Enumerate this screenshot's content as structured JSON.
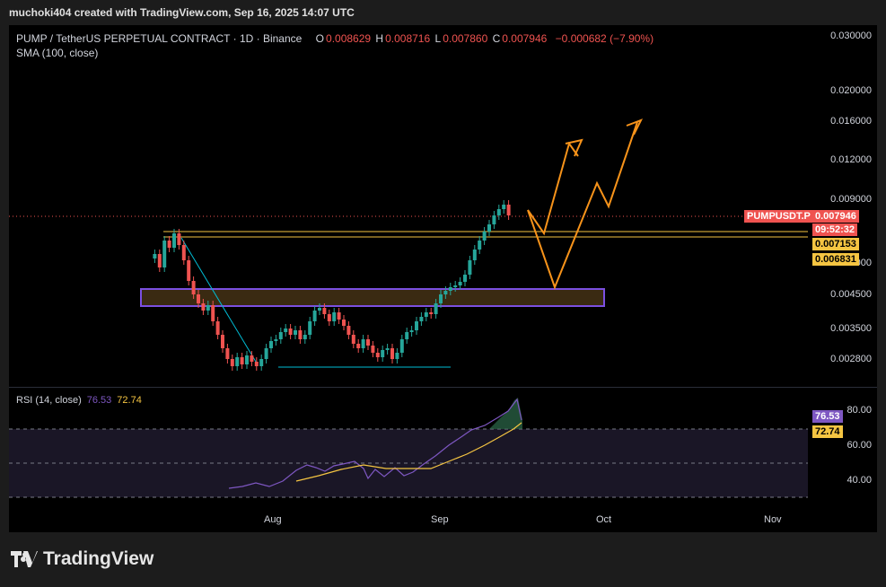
{
  "header": {
    "attribution": "muchoki404 created with TradingView.com, Sep 16, 2025 14:07 UTC"
  },
  "legend": {
    "symbol": "PUMP / TetherUS PERPETUAL CONTRACT · 1D · Binance",
    "open_label": "O",
    "open": "0.008629",
    "high_label": "H",
    "high": "0.008716",
    "low_label": "L",
    "low": "0.007860",
    "close_label": "C",
    "close": "0.007946",
    "change": "−0.000682 (−7.90%)",
    "sma": "SMA (100, close)"
  },
  "price_axis": [
    "0.030000",
    "0.020000",
    "0.016000",
    "0.012000",
    "0.009000",
    "0.006000",
    "0.004500",
    "0.003500",
    "0.002800"
  ],
  "price_tags": {
    "symbol_tag": "PUMPUSDT.P",
    "last_price": "0.007946",
    "countdown": "09:52:32",
    "level_1": "0.007153",
    "level_2": "0.006831"
  },
  "rsi": {
    "label": "RSI (14, close)",
    "value": "76.53",
    "ma_value": "72.74",
    "axis": [
      "80.00",
      "60.00",
      "40.00"
    ]
  },
  "time_axis": [
    "Aug",
    "Sep",
    "Oct",
    "Nov"
  ],
  "brand": {
    "name": "TradingView"
  },
  "colors": {
    "up": "#26a69a",
    "down": "#ef5350",
    "level": "#f5c542",
    "zone": "#6a3fd1",
    "arrow": "#f7931a",
    "trend": "#00bcd4",
    "rsi": "#7e57c2"
  }
}
